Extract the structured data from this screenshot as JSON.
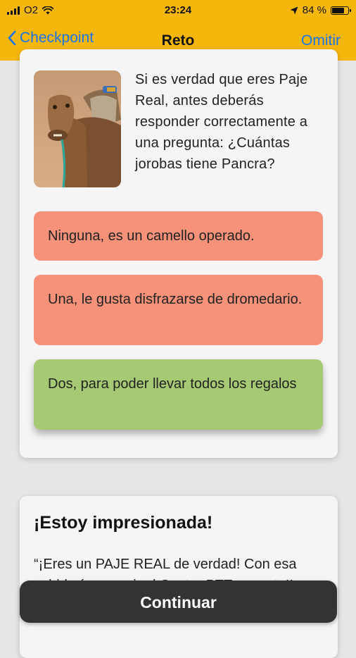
{
  "status_bar": {
    "carrier": "O2",
    "time": "23:24",
    "battery_text": "84 %",
    "battery_level": 0.84
  },
  "nav": {
    "back_label": "Checkpoint",
    "title": "Reto",
    "skip_label": "Omitir"
  },
  "question": {
    "text": "Si es verdad que eres Paje Real, antes deberás responder correctamente a una pregunta: ¿Cuántas jorobas tiene Pancra?",
    "answers": [
      {
        "label": "Ninguna, es un camello operado.",
        "state": "incorrect"
      },
      {
        "label": "Una, le gusta disfrazarse de dromedario.",
        "state": "incorrect"
      },
      {
        "label": "Dos, para poder llevar todos los regalos",
        "state": "correct"
      }
    ]
  },
  "result": {
    "title": "¡Estoy impresionada!",
    "text": "“¡Eres un PAJE REAL de verdad! Con esa sabiduría vas a ir al Centro PTT... suerte!!"
  },
  "footer": {
    "continue_label": "Continuar"
  },
  "colors": {
    "header": "#f6b70d",
    "link": "#1a73e8",
    "wrong": "#f6917a",
    "correct": "#a6c974",
    "button": "#333333"
  }
}
